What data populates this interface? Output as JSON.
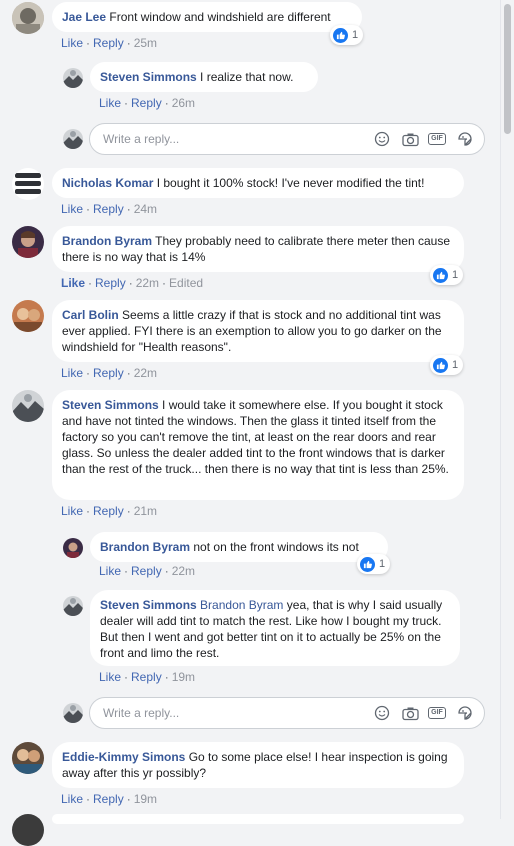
{
  "actions": {
    "like": "Like",
    "reply": "Reply",
    "separator": "·"
  },
  "reply_box": {
    "placeholder": "Write a reply..."
  },
  "reply_tools": {
    "emoji": "emoji-icon",
    "camera": "camera-icon",
    "gif": "GIF",
    "sticker": "sticker-icon"
  },
  "comments": [
    {
      "name": "Jae Lee",
      "text": "Front window and windshield are different",
      "time": "25m",
      "reactions": "1"
    },
    {
      "name": "Steven Simmons",
      "text": "I realize that now.",
      "time": "26m"
    },
    {
      "name": "Nicholas Komar",
      "text": "I bought it 100% stock! I've never modified the tint!",
      "time": "24m"
    },
    {
      "name": "Brandon Byram",
      "text": "They probably need to calibrate there meter then cause there is no way that is 14%",
      "time": "22m",
      "edited": "Edited",
      "reactions": "1"
    },
    {
      "name": "Carl Bolin",
      "text": "Seems a little crazy if that is stock and no additional tint was ever applied. FYI there is an exemption to allow you to go darker on the windshield for \"Health reasons\".",
      "time": "22m",
      "reactions": "1"
    },
    {
      "name": "Steven Simmons",
      "text": "I would take it somewhere else. If you bought it stock and have not tinted the windows. Then the glass it tinted itself from the factory so you can't remove the tint, at least on the rear doors and rear glass. So unless the dealer added tint to the front windows that is darker than the rest of the truck... then there is no way that tint is less than 25%.",
      "time": "21m"
    },
    {
      "name": "Brandon Byram",
      "text": "not on the front windows its not",
      "time": "22m",
      "reactions": "1"
    },
    {
      "name": "Steven Simmons",
      "mention": "Brandon Byram",
      "text": "yea, that is why I said usually dealer will add tint to match the rest. Like how I bought my truck. But then I went and got better tint on it to actually be 25% on the front and limo the rest.",
      "time": "19m"
    },
    {
      "name": "Eddie-Kimmy Simons",
      "text": "Go to some place else! I hear inspection is going away after this yr possibly?",
      "time": "19m"
    }
  ],
  "colors": {
    "link": "#385898",
    "action": "#4267b2",
    "like_badge": "#1877f2",
    "page_bg": "#f2f3f5",
    "bubble_bg": "#ffffff"
  }
}
